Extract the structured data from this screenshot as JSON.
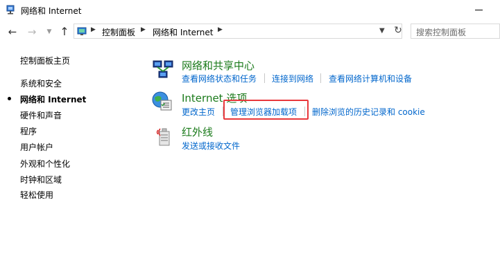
{
  "window": {
    "title": "网络和 Internet"
  },
  "address": {
    "crumbs": [
      "控制面板",
      "网络和 Internet"
    ]
  },
  "search": {
    "placeholder": "搜索控制面板"
  },
  "sidebar": {
    "items": [
      {
        "label": "控制面板主页",
        "active": false
      },
      {
        "label": "系统和安全",
        "active": false
      },
      {
        "label": "网络和 Internet",
        "active": true
      },
      {
        "label": "硬件和声音",
        "active": false
      },
      {
        "label": "程序",
        "active": false
      },
      {
        "label": "用户帐户",
        "active": false
      },
      {
        "label": "外观和个性化",
        "active": false
      },
      {
        "label": "时钟和区域",
        "active": false
      },
      {
        "label": "轻松使用",
        "active": false
      }
    ]
  },
  "categories": [
    {
      "title": "网络和共享中心",
      "icon": "network-sharing-icon",
      "links": [
        "查看网络状态和任务",
        "连接到网络",
        "查看网络计算机和设备"
      ]
    },
    {
      "title": "Internet 选项",
      "icon": "internet-options-icon",
      "links": [
        "更改主页",
        "管理浏览器加载项",
        "删除浏览的历史记录和 cookie"
      ]
    },
    {
      "title": "红外线",
      "icon": "infrared-icon",
      "links": [
        "发送或接收文件"
      ]
    }
  ],
  "colors": {
    "link": "#0066cc",
    "category_title": "#1a7a1a",
    "highlight": "#e8373b"
  }
}
